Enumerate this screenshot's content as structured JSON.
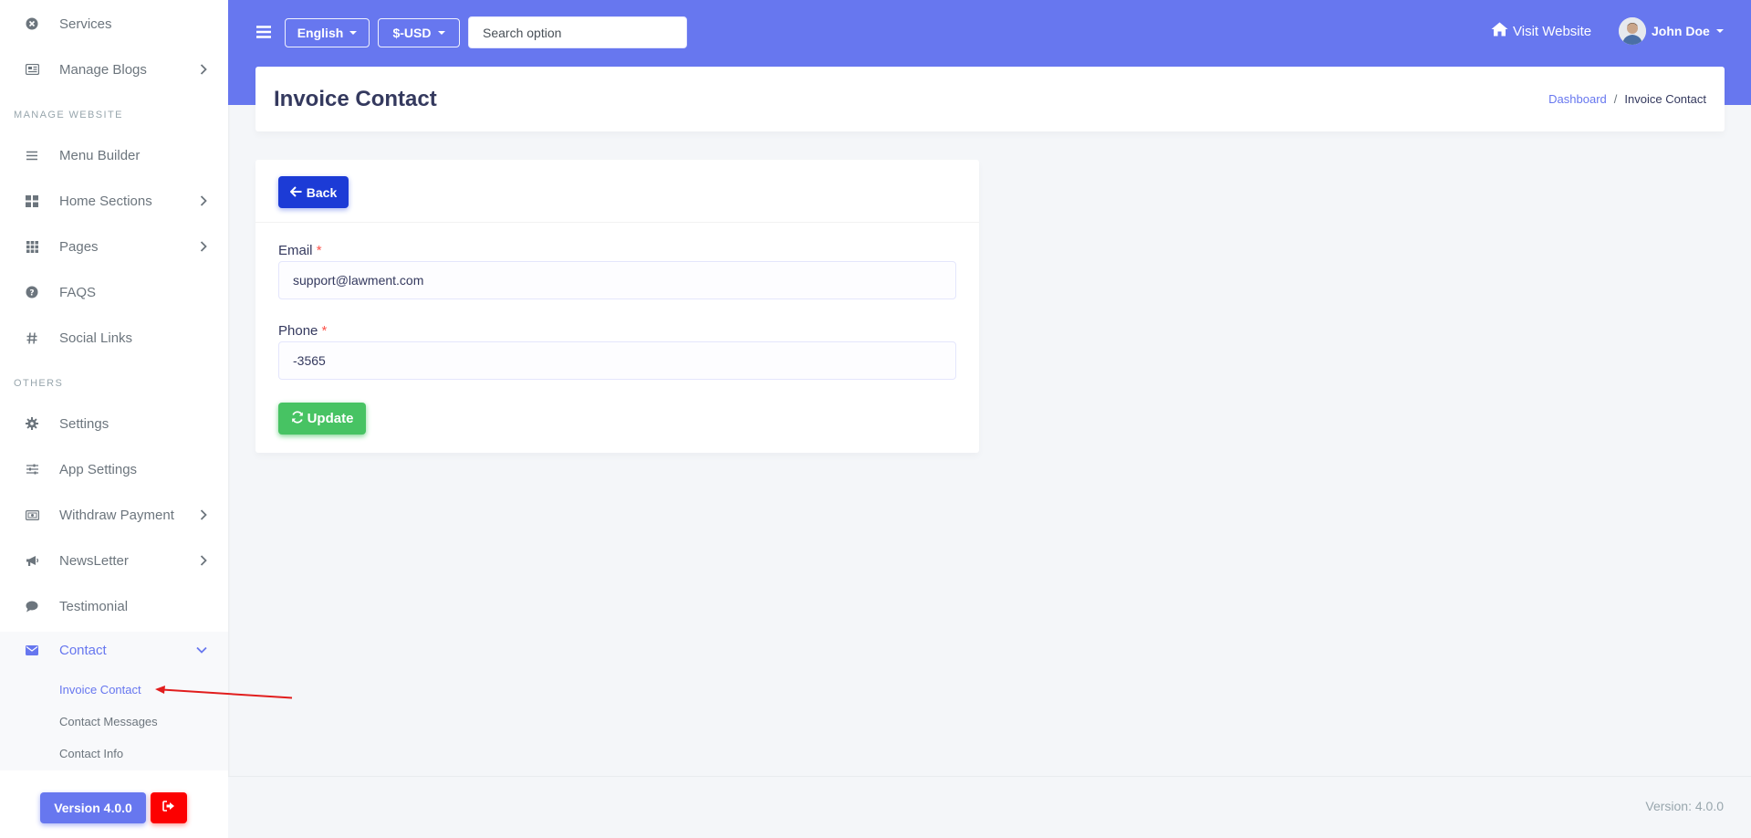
{
  "sidebar": {
    "items_top": [
      {
        "label": "Services",
        "icon": "times-circle-icon",
        "chevron": false
      },
      {
        "label": "Manage Blogs",
        "icon": "newspaper-icon",
        "chevron": true
      }
    ],
    "section_manage": "MANAGE WEBSITE",
    "items_manage": [
      {
        "label": "Menu Builder",
        "icon": "bars-icon",
        "chevron": false
      },
      {
        "label": "Home Sections",
        "icon": "grid-icon",
        "chevron": true
      },
      {
        "label": "Pages",
        "icon": "th-icon",
        "chevron": true
      },
      {
        "label": "FAQS",
        "icon": "question-circle-icon",
        "chevron": false
      },
      {
        "label": "Social Links",
        "icon": "hashtag-icon",
        "chevron": false
      }
    ],
    "section_others": "OTHERS",
    "items_others": [
      {
        "label": "Settings",
        "icon": "cog-icon",
        "chevron": false
      },
      {
        "label": "App Settings",
        "icon": "sliders-icon",
        "chevron": false
      },
      {
        "label": "Withdraw Payment",
        "icon": "money-icon",
        "chevron": true
      },
      {
        "label": "NewsLetter",
        "icon": "bullhorn-icon",
        "chevron": true
      },
      {
        "label": "Testimonial",
        "icon": "comment-icon",
        "chevron": false
      },
      {
        "label": "Contact",
        "icon": "envelope-icon",
        "chevron": true
      }
    ],
    "contact_sub": [
      {
        "label": "Invoice Contact"
      },
      {
        "label": "Contact Messages"
      },
      {
        "label": "Contact Info"
      }
    ],
    "version_label": "Version 4.0.0"
  },
  "topbar": {
    "language": "English",
    "currency": "$-USD",
    "search_placeholder": "Search option",
    "visit_label": "Visit Website",
    "user_name": "John Doe"
  },
  "header": {
    "title": "Invoice Contact",
    "breadcrumb": [
      "Dashboard",
      "Invoice Contact"
    ]
  },
  "form": {
    "back_label": "Back",
    "email_label": "Email",
    "email_value": "support@lawment.com",
    "phone_label": "Phone",
    "phone_value": "-3565",
    "required_mark": "*",
    "update_label": "Update"
  },
  "footer": {
    "version_text": "Version: 4.0.0"
  },
  "colors": {
    "primary": "#6777ef",
    "back_button": "#1c3bd6",
    "success": "#47c363",
    "danger": "#fc0000"
  }
}
